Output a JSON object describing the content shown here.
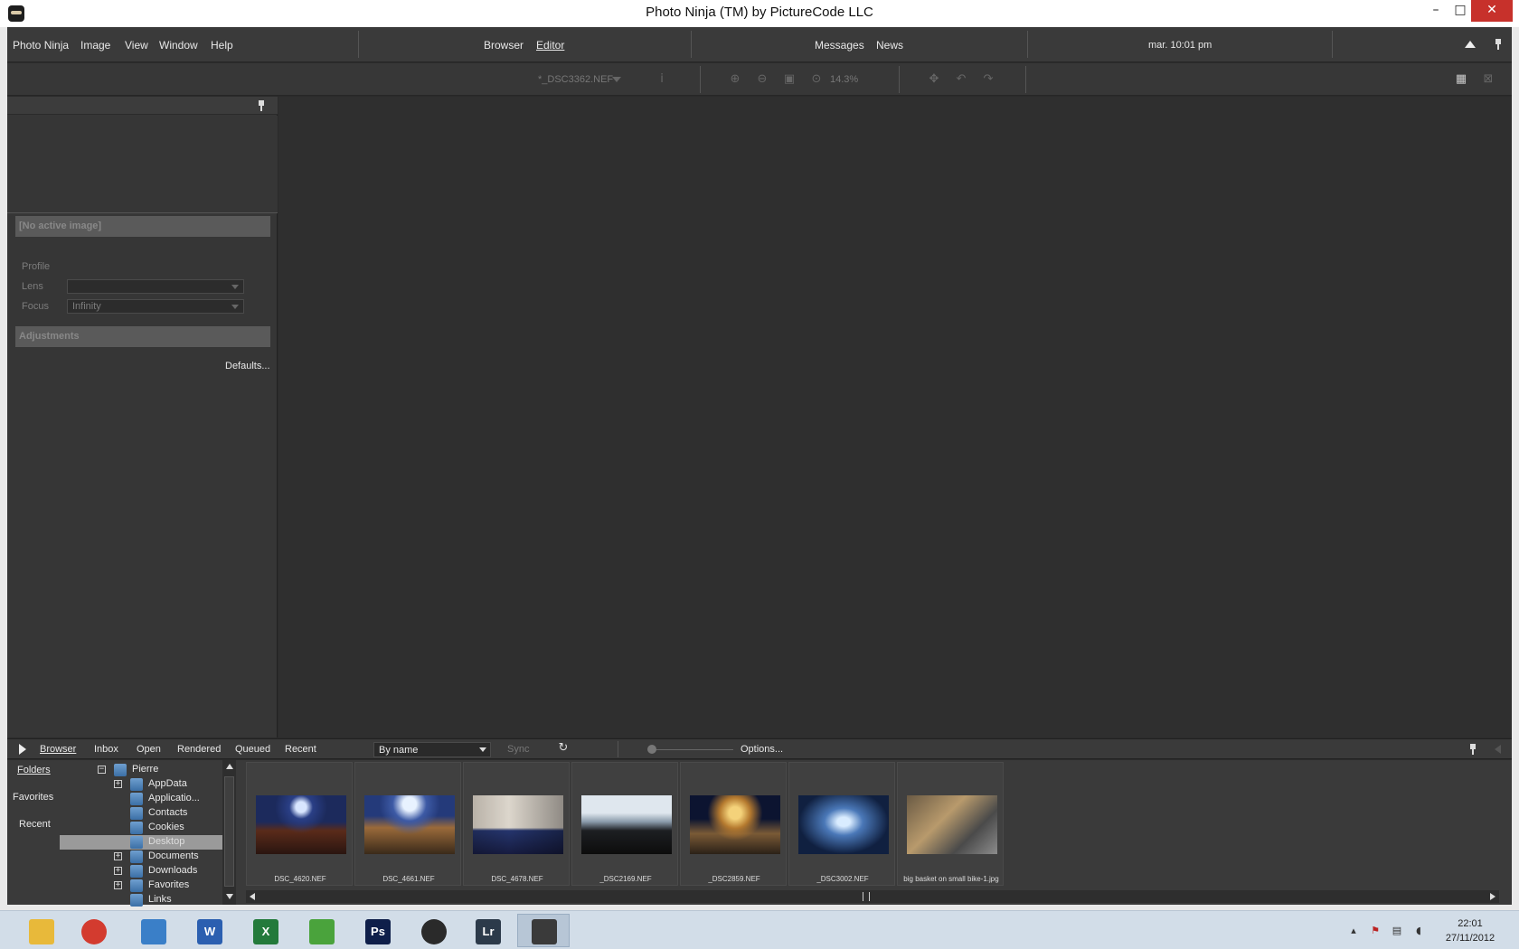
{
  "window": {
    "title": "Photo Ninja (TM) by PictureCode LLC"
  },
  "menu": {
    "items": [
      "Photo Ninja",
      "Image",
      "View",
      "Window",
      "Help"
    ],
    "modes": [
      "Browser",
      "Editor"
    ],
    "messages": "Messages",
    "news": "News",
    "time": "mar. 10:01 pm"
  },
  "toolbar": {
    "filename": "*_DSC3362.NEF",
    "zoom": "14.3%"
  },
  "left_panel": {
    "active_image": "[No active image]",
    "profile_label": "Profile",
    "lens_label": "Lens",
    "lens_value": "",
    "focus_label": "Focus",
    "focus_value": "Infinity",
    "adjustments_label": "Adjustments",
    "defaults_label": "Defaults..."
  },
  "browser_bar": {
    "tabs": [
      "Browser",
      "Inbox",
      "Open",
      "Rendered",
      "Queued",
      "Recent"
    ],
    "sort_value": "By name",
    "sync_label": "Sync",
    "options_label": "Options..."
  },
  "sources": [
    "Folders",
    "Favorites",
    "Recent"
  ],
  "tree": [
    {
      "label": "Pierre",
      "expander": "−"
    },
    {
      "label": "AppData",
      "expander": "+"
    },
    {
      "label": "Applicatio...",
      "expander": ""
    },
    {
      "label": "Contacts",
      "expander": ""
    },
    {
      "label": "Cookies",
      "expander": ""
    },
    {
      "label": "Desktop",
      "expander": ""
    },
    {
      "label": "Documents",
      "expander": "+"
    },
    {
      "label": "Downloads",
      "expander": "+"
    },
    {
      "label": "Favorites",
      "expander": "+"
    },
    {
      "label": "Links",
      "expander": ""
    }
  ],
  "thumbnails": [
    {
      "name": "DSC_4620.NEF"
    },
    {
      "name": "DSC_4661.NEF"
    },
    {
      "name": "DSC_4678.NEF"
    },
    {
      "name": "_DSC2169.NEF"
    },
    {
      "name": "_DSC2859.NEF"
    },
    {
      "name": "_DSC3002.NEF"
    },
    {
      "name": "big basket on small bike-1.jpg"
    }
  ],
  "taskbar": {
    "apps": [
      {
        "icon": "file-explorer-icon",
        "text": "",
        "color": "#e8b93a"
      },
      {
        "icon": "chrome-icon",
        "text": "",
        "color": "#d33b2f"
      },
      {
        "icon": "media-center-icon",
        "text": "",
        "color": "#3a7fc8"
      },
      {
        "icon": "word-icon",
        "text": "W",
        "color": "#2b5fb0"
      },
      {
        "icon": "excel-icon",
        "text": "X",
        "color": "#237a3b"
      },
      {
        "icon": "messenger-icon",
        "text": "",
        "color": "#4aa33c"
      },
      {
        "icon": "photoshop-icon",
        "text": "Ps",
        "color": "#0f1f4a"
      },
      {
        "icon": "aperture-icon",
        "text": "",
        "color": "#2a2a2a"
      },
      {
        "icon": "lightroom-icon",
        "text": "Lr",
        "color": "#2c3a4a"
      },
      {
        "icon": "photo-ninja-icon",
        "text": "",
        "color": "#3a3a3a"
      }
    ],
    "time": "22:01",
    "date": "27/11/2012"
  }
}
